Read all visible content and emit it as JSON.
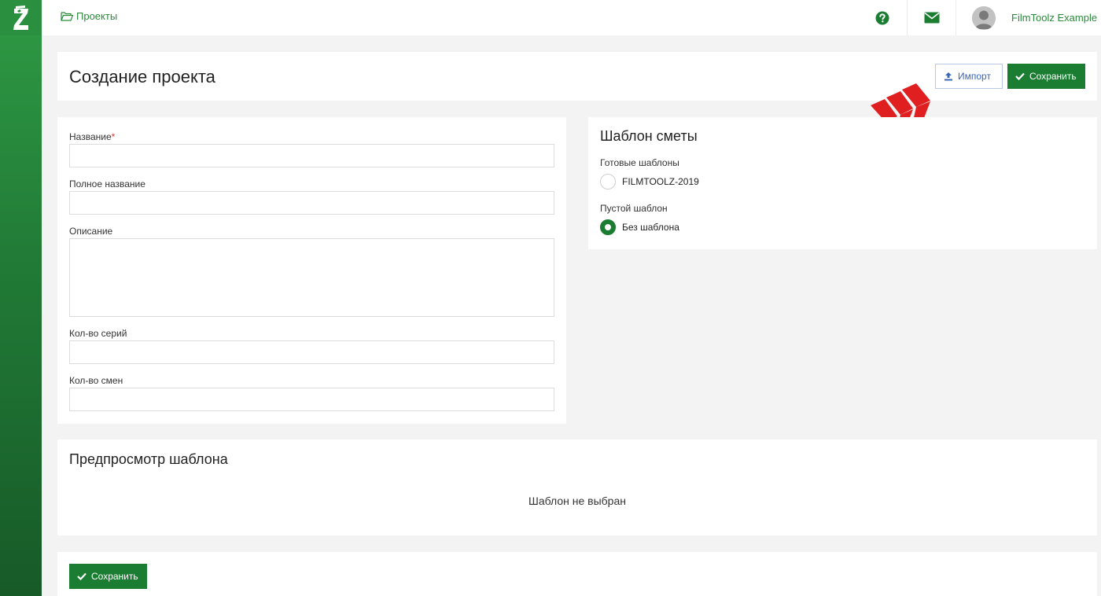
{
  "app": {
    "logo_letter": "Z",
    "brand_color": "#1a7d32",
    "accent_green": "#2a8a3a"
  },
  "topbar": {
    "breadcrumb": "Проекты",
    "help_icon": "question-circle-icon",
    "mail_icon": "envelope-icon",
    "user_name": "FilmToolz Example"
  },
  "header": {
    "title": "Создание проекта",
    "import_label": "Импорт",
    "save_label": "Сохранить"
  },
  "form": {
    "name_label": "Название",
    "required_mark": "*",
    "full_name_label": "Полное название",
    "description_label": "Описание",
    "series_count_label": "Кол-во серий",
    "shifts_count_label": "Кол-во смен"
  },
  "template": {
    "title": "Шаблон сметы",
    "ready_label": "Готовые шаблоны",
    "ready_option": "FILMTOOLZ-2019",
    "empty_label": "Пустой шаблон",
    "empty_option": "Без шаблона",
    "selected": "Без шаблона"
  },
  "preview": {
    "title": "Предпросмотр шаблона",
    "empty_text": "Шаблон не выбран"
  },
  "footer": {
    "save_label": "Сохранить"
  }
}
